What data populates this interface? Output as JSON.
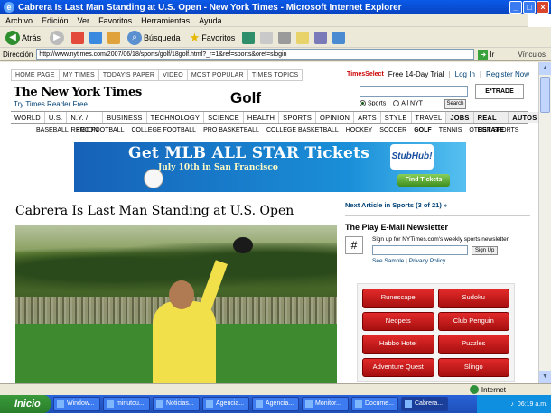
{
  "window": {
    "title": "Cabrera Is Last Man Standing at U.S. Open - New York Times - Microsoft Internet Explorer"
  },
  "menubar": [
    "Archivo",
    "Edición",
    "Ver",
    "Favoritos",
    "Herramientas",
    "Ayuda"
  ],
  "toolbar": {
    "back": "Atrás",
    "search": "Búsqueda",
    "favorites": "Favoritos"
  },
  "address": {
    "label": "Dirección",
    "url": "http://www.nytimes.com/2007/06/18/sports/golf/18golf.html?_r=1&ref=sports&oref=slogin",
    "go": "Ir",
    "links": "Vínculos"
  },
  "page": {
    "topnav": [
      "HOME PAGE",
      "MY TIMES",
      "TODAY'S PAPER",
      "VIDEO",
      "MOST POPULAR",
      "TIMES TOPICS"
    ],
    "timesselect": "TimesSelect",
    "trial": "Free 14-Day Trial",
    "login": "Log In",
    "register": "Register Now",
    "logo": "The New York Times",
    "reader": "Try Times Reader Free",
    "section": "Golf",
    "search_options": [
      "Sports",
      "All NYT"
    ],
    "search_button": "Search",
    "etrade": "E*TRADE",
    "mainnav": [
      "WORLD",
      "U.S.",
      "N.Y. / REGION",
      "BUSINESS",
      "TECHNOLOGY",
      "SCIENCE",
      "HEALTH",
      "SPORTS",
      "OPINION",
      "ARTS",
      "STYLE",
      "TRAVEL",
      "JOBS",
      "REAL ESTATE",
      "AUTOS"
    ],
    "subnav": [
      "BASEBALL",
      "PRO FOOTBALL",
      "COLLEGE FOOTBALL",
      "PRO BASKETBALL",
      "COLLEGE BASKETBALL",
      "HOCKEY",
      "SOCCER",
      "GOLF",
      "TENNIS",
      "OTHER SPORTS"
    ],
    "banner": {
      "headline": "Get MLB ALL STAR Tickets",
      "sub": "July 10th in San Francisco",
      "brand": "StubHub!",
      "button": "Find Tickets"
    },
    "article_title": "Cabrera Is Last Man Standing at U.S. Open",
    "rail": {
      "next": "Next Article in Sports (3 of 21) »",
      "newsletter_title": "The Play E-Mail Newsletter",
      "newsletter_text": "Sign up for NYTimes.com's weekly sports newsletter.",
      "signup": "Sign Up",
      "see_sample": "See Sample",
      "privacy": "Privacy Policy"
    },
    "games": [
      "Runescape",
      "Sudoku",
      "Neopets",
      "Club Penguin",
      "Habbo Hotel",
      "Puzzles",
      "Adventure Quest",
      "Slingo"
    ]
  },
  "statusbar": {
    "zone": "Internet"
  },
  "taskbar": {
    "start": "Inicio",
    "tasks": [
      "Window...",
      "minutou...",
      "Noticias...",
      "Agencia...",
      "Agencia...",
      "Monitor...",
      "Docume...",
      "Cabrera..."
    ],
    "clock": "06:19 a.m."
  }
}
